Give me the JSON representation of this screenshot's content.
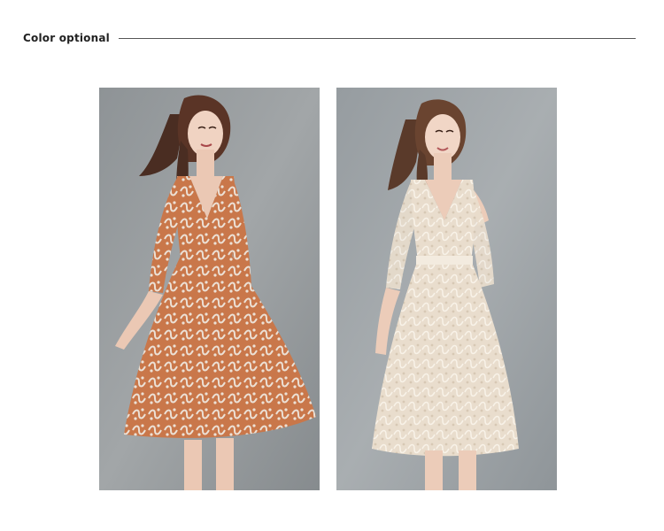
{
  "section": {
    "title": "Color optional"
  },
  "photos": [
    {
      "name": "orange-lace-dress-photo",
      "dress_color": "#c9774a",
      "lace_color": "#ece1d6",
      "background": "#93979a"
    },
    {
      "name": "beige-lace-dress-photo",
      "dress_color": "#e9ddcd",
      "lace_color": "#f6efe4",
      "background": "#9ba1a5"
    }
  ]
}
